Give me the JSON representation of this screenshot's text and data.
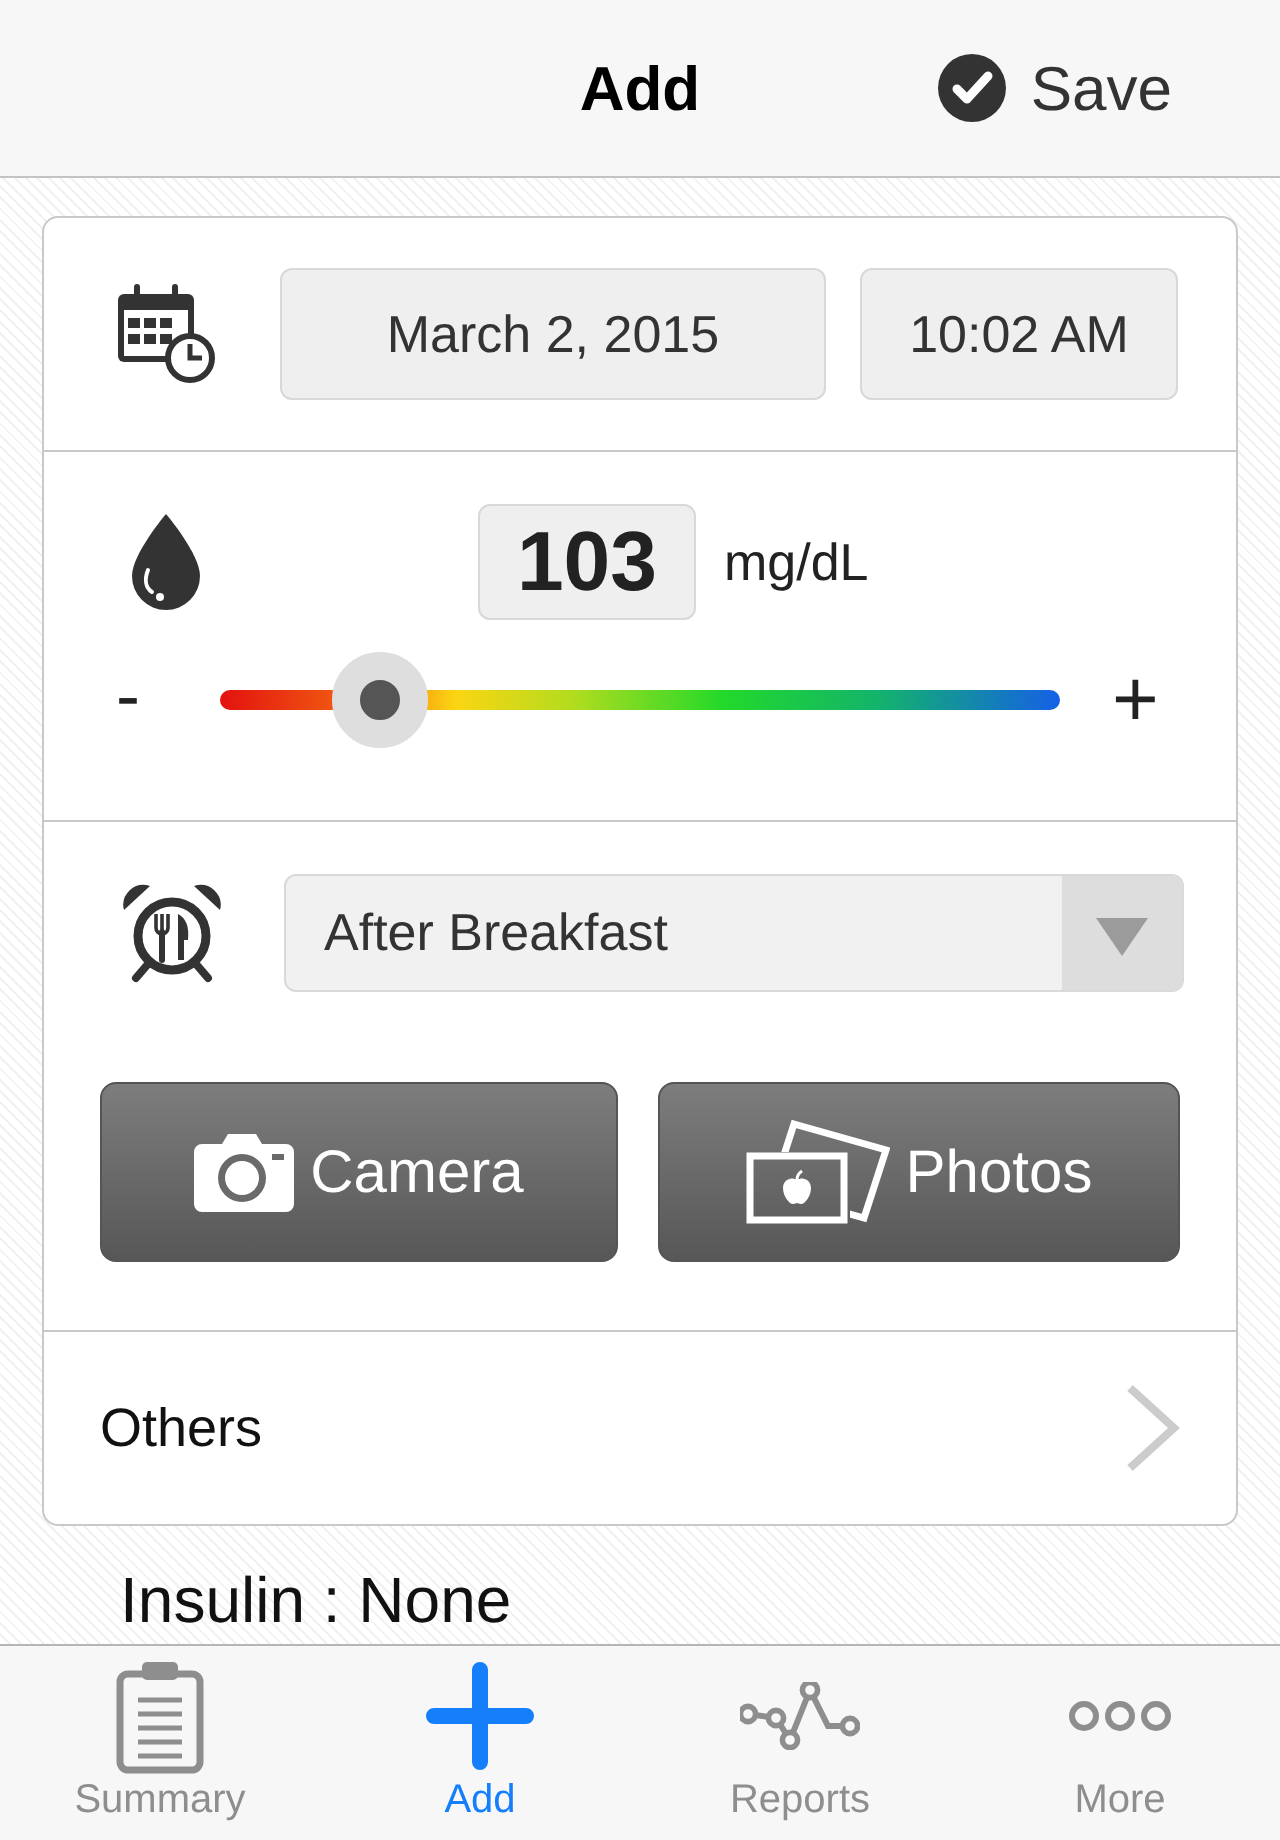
{
  "header": {
    "title": "Add",
    "save_label": "Save"
  },
  "datetime": {
    "date": "March 2, 2015",
    "time": "10:02 AM"
  },
  "glucose": {
    "value": "103",
    "unit": "mg/dL",
    "minus": "-",
    "plus": "+",
    "level": 0.19
  },
  "meal": {
    "value": "After Breakfast"
  },
  "media_buttons": [
    {
      "label": "Camera"
    },
    {
      "label": "Photos"
    }
  ],
  "others": {
    "label": "Others"
  },
  "insulin": {
    "text": "Insulin : None"
  },
  "tabs": [
    {
      "label": "Summary",
      "selected": false
    },
    {
      "label": "Add",
      "selected": true
    },
    {
      "label": "Reports",
      "selected": false
    },
    {
      "label": "More",
      "selected": false
    }
  ]
}
